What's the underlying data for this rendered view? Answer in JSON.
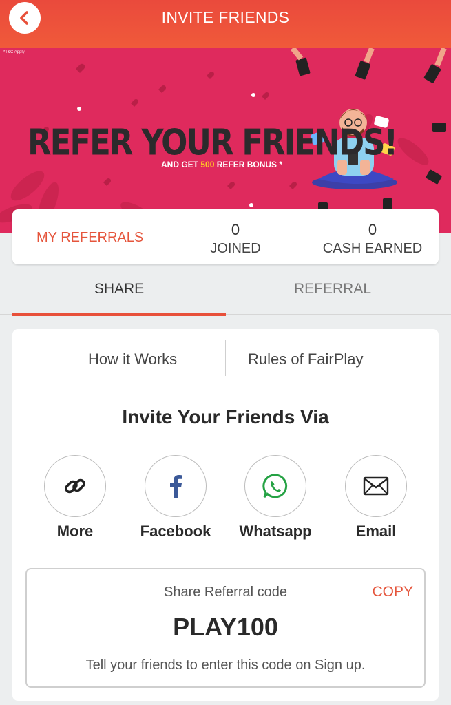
{
  "header": {
    "title": "INVITE FRIENDS"
  },
  "banner": {
    "tnc": "*T&C Apply",
    "headline": "REFER YOUR FRIENDS!",
    "sub_prefix": "AND GET ",
    "sub_amount": "500",
    "sub_suffix": " REFER BONUS *"
  },
  "stats": {
    "my_referrals_label": "MY REFERRALS",
    "joined_value": "0",
    "joined_label": "JOINED",
    "cash_value": "0",
    "cash_label": "CASH EARNED"
  },
  "tabs": [
    {
      "label": "SHARE",
      "active": true
    },
    {
      "label": "REFERRAL",
      "active": false
    }
  ],
  "links": {
    "how_it_works": "How it Works",
    "rules": "Rules of FairPlay"
  },
  "invite": {
    "title": "Invite Your Friends Via",
    "options": [
      {
        "label": "More",
        "icon": "link-icon"
      },
      {
        "label": "Facebook",
        "icon": "facebook-icon"
      },
      {
        "label": "Whatsapp",
        "icon": "whatsapp-icon"
      },
      {
        "label": "Email",
        "icon": "envelope-icon"
      }
    ]
  },
  "referral_code": {
    "label": "Share Referral code",
    "copy_label": "COPY",
    "code": "PLAY100",
    "hint": "Tell your friends to enter this code on Sign up."
  },
  "colors": {
    "header": "#ea4a3c",
    "banner": "#df2a5d",
    "accent": "#e5553c",
    "facebook": "#3b5998",
    "whatsapp": "#25a244"
  }
}
